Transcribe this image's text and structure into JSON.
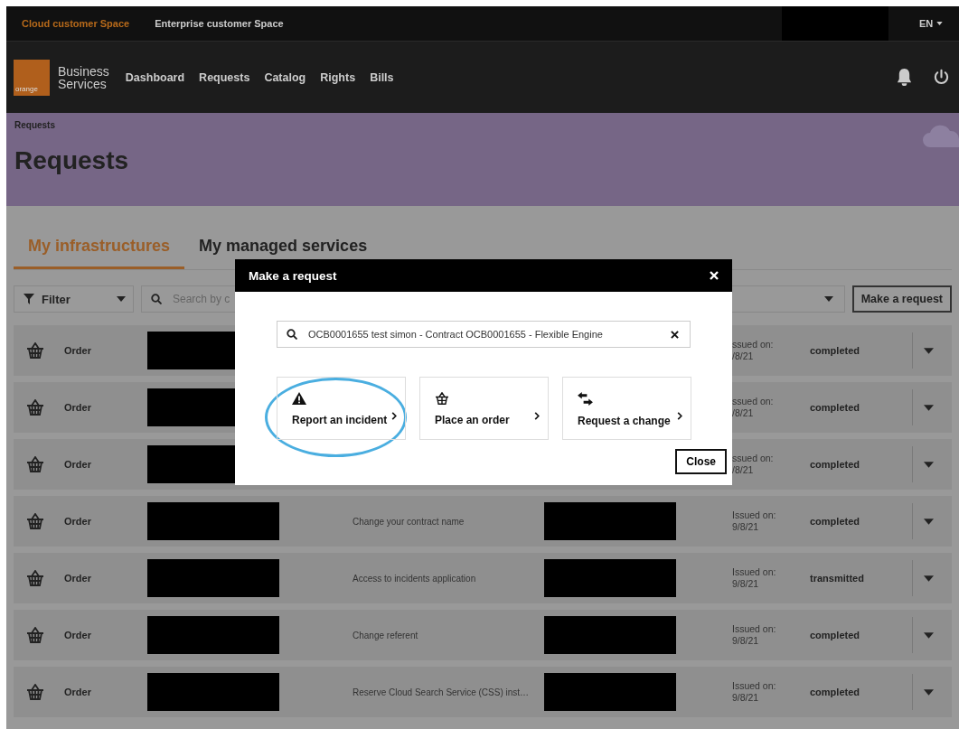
{
  "top_bar": {
    "spaces": [
      {
        "label": "Cloud customer Space",
        "selected": true
      },
      {
        "label": "Enterprise customer Space",
        "selected": false
      }
    ],
    "language": "EN"
  },
  "nav": {
    "logo_text": "orange",
    "brand": [
      "Business",
      "Services"
    ],
    "items": [
      "Dashboard",
      "Requests",
      "Catalog",
      "Rights",
      "Bills"
    ]
  },
  "header": {
    "breadcrumb": "Requests",
    "title": "Requests"
  },
  "tabs": [
    {
      "label": "My infrastructures",
      "selected": true
    },
    {
      "label": "My managed services",
      "selected": false
    }
  ],
  "toolbar": {
    "filter": "Filter",
    "search_placeholder": "Search by c",
    "make_request": "Make a request"
  },
  "rows": [
    {
      "type": "Order",
      "issued_label": "ssued on:",
      "issued_date": "/8/21",
      "status": "completed"
    },
    {
      "type": "Order",
      "issued_label": "ssued on:",
      "issued_date": "/8/21",
      "status": "completed"
    },
    {
      "type": "Order",
      "issued_label": "ssued on:",
      "issued_date": "/8/21",
      "status": "completed"
    },
    {
      "type": "Order",
      "description": "Change your contract name",
      "issued_label": "Issued on:",
      "issued_date": "9/8/21",
      "status": "completed"
    },
    {
      "type": "Order",
      "description": "Access to incidents application",
      "issued_label": "Issued on:",
      "issued_date": "9/8/21",
      "status": "transmitted"
    },
    {
      "type": "Order",
      "description": "Change referent",
      "issued_label": "Issued on:",
      "issued_date": "9/8/21",
      "status": "completed"
    },
    {
      "type": "Order",
      "description": "Reserve Cloud Search Service (CSS) inst…",
      "issued_label": "Issued on:",
      "issued_date": "9/8/21",
      "status": "completed"
    }
  ],
  "modal": {
    "title": "Make a request",
    "search_value": "OCB0001655 test simon - Contract OCB0001655 - Flexible Engine",
    "options": [
      {
        "kind": "incident",
        "label": "Report an incident",
        "highlighted": true
      },
      {
        "kind": "order",
        "label": "Place an order",
        "highlighted": false
      },
      {
        "kind": "change",
        "label": "Request a change",
        "highlighted": false
      }
    ],
    "close": "Close"
  }
}
